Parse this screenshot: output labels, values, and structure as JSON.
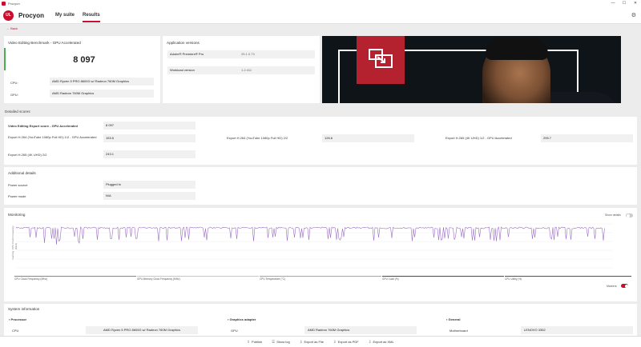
{
  "window": {
    "title": "Procyon",
    "controls": [
      "—",
      "☐",
      "✕"
    ]
  },
  "nav": {
    "logo_text": "UL",
    "brand": "Procyon",
    "tabs": [
      "My suite",
      "Results"
    ],
    "active_tab": "Results"
  },
  "back_label": "Back",
  "summary": {
    "title": "Video Editing Benchmark - GPU Accelerated",
    "score": "8 097",
    "cpu_label": "CPU:",
    "cpu_value": "AMD Ryzen 5 PRO 8600G w/ Radeon 760M Graphics",
    "gpu_label": "GPU:",
    "gpu_value": "AMD Radeon 760M Graphics"
  },
  "app_versions": {
    "title": "Application versions",
    "rows": [
      {
        "name": "Adobe® Premiere® Pro",
        "version": "25.1.0.73"
      },
      {
        "name": "Workload version",
        "version": "1.2.411"
      }
    ]
  },
  "detailed_scores": {
    "title": "Detailed scores",
    "main_label": "Video Editing Export score - GPU Accelerated",
    "main_value": "8 097",
    "items": [
      {
        "label": "Export H.264 (YouTube 1080p Full HD) 1/2 - GPU Accelerated",
        "value": "153.5"
      },
      {
        "label": "Export H.264 (YouTube 1080p Full HD) 2/2",
        "value": "126.6"
      },
      {
        "label": "Export H.265 (4K UHD) 1/2 - GPU Accelerated",
        "value": "295.7"
      },
      {
        "label": "Export H.265 (4K UHD) 2/2",
        "value": "243.1"
      }
    ]
  },
  "additional_details": {
    "title": "Additional details",
    "rows": [
      {
        "label": "Power source",
        "value": "Plugged in"
      },
      {
        "label": "Power mode",
        "value": "N/A"
      }
    ]
  },
  "monitoring": {
    "title": "Monitoring",
    "show_details_label": "Show details",
    "markers_label": "Markers",
    "y_axis_label": "CPU Clock Frequency (MHz)",
    "y_axis_label2": "Gaming",
    "legend": [
      {
        "label": "CPU Clock Frequency (MHz)",
        "color": "#9c6fc6"
      },
      {
        "label": "GPU Memory Clock Frequency (MHz)",
        "color": "#e8c96a"
      },
      {
        "label": "CPU Temperature (°C)",
        "color": "#4ecdc4"
      },
      {
        "label": "GPU Load (%)",
        "color": "#c8102e"
      },
      {
        "label": "CPU Utility (%)",
        "color": "#1f5f8b"
      }
    ],
    "accent": "#9c6fc6"
  },
  "system_info": {
    "title": "System information",
    "columns": [
      {
        "heading": "Processor",
        "icon": "cpu-icon",
        "row_label": "CPU",
        "row_value": "AMD Ryzen 5 PRO 8600G w/ Radeon 760M Graphics"
      },
      {
        "heading": "Graphics adapter",
        "icon": "gpu-icon",
        "row_label": "GPU",
        "row_value": "AMD Radeon 760M Graphics"
      },
      {
        "heading": "General",
        "icon": "info-icon",
        "row_label": "Motherboard",
        "row_value": "LENOVO 3352"
      }
    ]
  },
  "footer": {
    "buttons": [
      {
        "label": "Publish",
        "icon": "publish-icon"
      },
      {
        "label": "Show log",
        "icon": "log-icon"
      },
      {
        "label": "Export as File",
        "icon": "file-icon"
      },
      {
        "label": "Export as PDF",
        "icon": "pdf-icon"
      },
      {
        "label": "Export as XML",
        "icon": "xml-icon"
      }
    ]
  },
  "colors": {
    "brand": "#c8102e",
    "score_accent": "#4caf50"
  }
}
